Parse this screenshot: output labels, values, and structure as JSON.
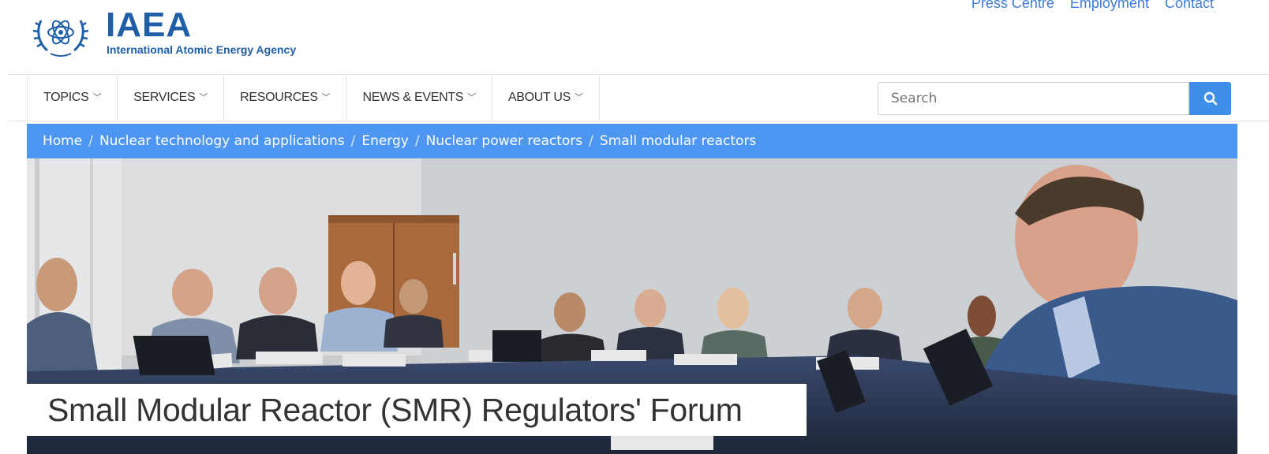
{
  "brand": {
    "acronym": "IAEA",
    "name": "International Atomic Energy Agency"
  },
  "top_links": [
    "Press Centre",
    "Employment",
    "Contact"
  ],
  "nav": {
    "items": [
      {
        "label": "TOPICS"
      },
      {
        "label": "SERVICES"
      },
      {
        "label": "RESOURCES"
      },
      {
        "label": "NEWS & EVENTS"
      },
      {
        "label": "ABOUT US"
      }
    ],
    "search_placeholder": "Search",
    "search_icon": "search-icon"
  },
  "breadcrumb": [
    "Home",
    "Nuclear technology and applications",
    "Energy",
    "Nuclear power reactors",
    "Small modular reactors"
  ],
  "hero": {
    "title": "Small Modular Reactor (SMR) Regulators' Forum"
  },
  "colors": {
    "brand_blue": "#1f5fa8",
    "link_blue": "#3d7dd8",
    "breadcrumb_bg": "#4d97f2",
    "search_button": "#3d8fe8"
  }
}
